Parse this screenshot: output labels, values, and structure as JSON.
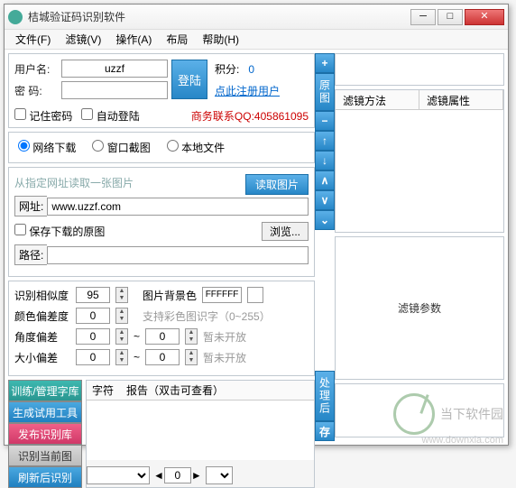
{
  "title": "桔城验证码识别软件",
  "menu": [
    "文件(F)",
    "滤镜(V)",
    "操作(A)",
    "布局",
    "帮助(H)"
  ],
  "login": {
    "userLabel": "用户名:",
    "userValue": "uzzf",
    "passLabel": "密   码:",
    "passValue": "",
    "loginBtn": "登陆",
    "pointsLabel": "积分:",
    "pointsValue": "0",
    "registerLink": "点此注册用户",
    "remember": "记住密码",
    "autoLogin": "自动登陆",
    "contact": "商务联系QQ:405861095"
  },
  "source": {
    "netDownload": "网络下载",
    "windowShot": "窗口截图",
    "localFile": "本地文件"
  },
  "download": {
    "hint": "从指定网址读取一张图片",
    "readBtn": "读取图片",
    "urlLabel": "网址:",
    "urlValue": "www.uzzf.com",
    "saveOriginal": "保存下载的原图",
    "browse": "浏览...",
    "pathLabel": "路径:",
    "pathValue": ""
  },
  "settings": {
    "sim": "识别相似度",
    "simVal": "95",
    "bgLabel": "图片背景色",
    "bgVal": "FFFFFF",
    "colorDev": "颜色偏差度",
    "colorVal": "0",
    "colorHint": "支持彩色图识字（0~255）",
    "angleDev": "角度偏差",
    "angleVal": "0",
    "angleVal2": "0",
    "na1": "暂未开放",
    "sizeDev": "大小偏差",
    "sizeVal": "0",
    "sizeVal2": "0",
    "na2": "暂未开放"
  },
  "sidebtns": {
    "train": "训练/管理字库",
    "gen": "生成试用工具",
    "pub": "发布识别库",
    "rec": "识别当前图",
    "refresh": "刷新后识别"
  },
  "charHdr": {
    "char": "字符",
    "report": "报告（双击可查看）"
  },
  "midLabels": {
    "orig": "原图",
    "proc": "处理后",
    "save": "存"
  },
  "rightHdr": {
    "method": "滤镜方法",
    "attr": "滤镜属性"
  },
  "rightCenter": "滤镜参数",
  "bottomCombo": "0",
  "watermark": {
    "name": "当下软件园",
    "url": "www.downxia.com"
  }
}
